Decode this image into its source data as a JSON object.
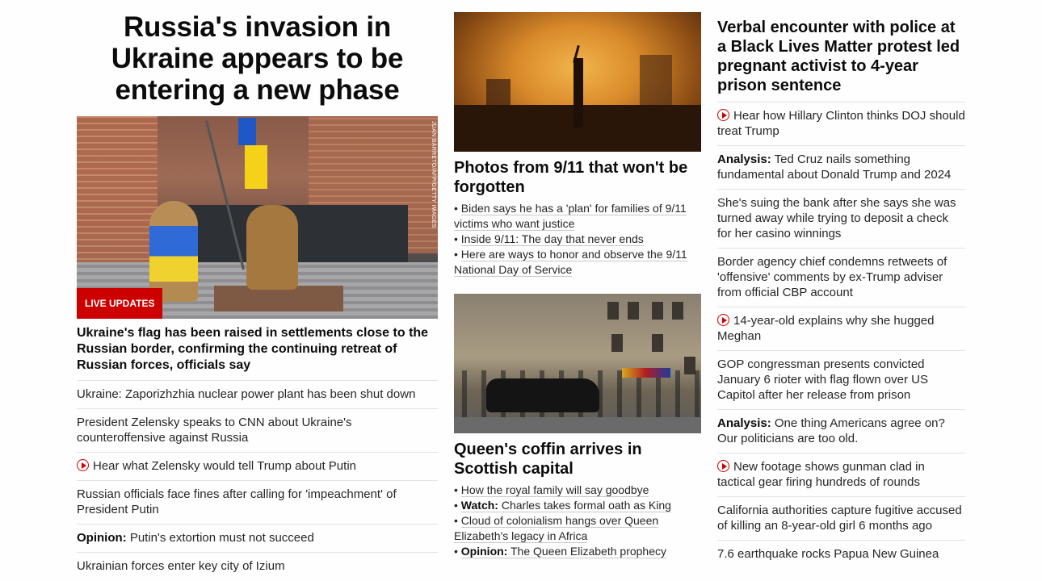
{
  "col1": {
    "hero_title": "Russia's invasion in Ukraine appears to be entering a new phase",
    "photo_credit": "JUAN BARRETO/AFP/GETTY IMAGES",
    "badge": "LIVE UPDATES",
    "lead_headline": "Ukraine's flag has been raised in settlements close to the Russian border, confirming the continuing retreat of Russian forces, officials say",
    "stories": [
      {
        "prefix": "",
        "text": "Ukraine: Zaporizhzhia nuclear power plant has been shut down",
        "video": false
      },
      {
        "prefix": "",
        "text": "President Zelensky speaks to CNN about Ukraine's counteroffensive against Russia",
        "video": false
      },
      {
        "prefix": "",
        "text": "Hear what Zelensky would tell Trump about Putin",
        "video": true
      },
      {
        "prefix": "",
        "text": "Russian officials face fines after calling for 'impeachment' of President Putin",
        "video": false
      },
      {
        "prefix": "Opinion:",
        "text": "Putin's extortion must not succeed",
        "video": false
      },
      {
        "prefix": "",
        "text": "Ukrainian forces enter key city of Izium",
        "video": false
      }
    ]
  },
  "col2": {
    "sec1": {
      "headline": "Photos from 9/11 that won't be forgotten",
      "bullets": [
        {
          "prefix": "",
          "text": "Biden says he has a 'plan' for families of 9/11 victims who want justice"
        },
        {
          "prefix": "",
          "text": "Inside 9/11: The day that never ends"
        },
        {
          "prefix": "",
          "text": "Here are ways to honor and observe the 9/11 National Day of Service"
        }
      ]
    },
    "sec2": {
      "headline": "Queen's coffin arrives in Scottish capital",
      "bullets": [
        {
          "prefix": "",
          "text": "How the royal family will say goodbye"
        },
        {
          "prefix": "Watch:",
          "text": "Charles takes formal oath as King"
        },
        {
          "prefix": "",
          "text": "Cloud of colonialism hangs over Queen Elizabeth's legacy in Africa"
        },
        {
          "prefix": "Opinion:",
          "text": "The Queen Elizabeth prophecy"
        }
      ]
    }
  },
  "col3": {
    "headline": "Verbal encounter with police at a Black Lives Matter protest led pregnant activist to 4-year prison sentence",
    "stories": [
      {
        "prefix": "",
        "text": "Hear how Hillary Clinton thinks DOJ should treat Trump",
        "video": true
      },
      {
        "prefix": "Analysis:",
        "text": "Ted Cruz nails something fundamental about Donald Trump and 2024",
        "video": false
      },
      {
        "prefix": "",
        "text": "She's suing the bank after she says she was turned away while trying to deposit a check for her casino winnings",
        "video": false
      },
      {
        "prefix": "",
        "text": "Border agency chief condemns retweets of 'offensive' comments by ex-Trump adviser from official CBP account",
        "video": false
      },
      {
        "prefix": "",
        "text": "14-year-old explains why she hugged Meghan",
        "video": true
      },
      {
        "prefix": "",
        "text": "GOP congressman presents convicted January 6 rioter with flag flown over US Capitol after her release from prison",
        "video": false
      },
      {
        "prefix": "Analysis:",
        "text": "One thing Americans agree on? Our politicians are too old.",
        "video": false
      },
      {
        "prefix": "",
        "text": "New footage shows gunman clad in tactical gear firing hundreds of rounds",
        "video": true
      },
      {
        "prefix": "",
        "text": "California authorities capture fugitive accused of killing an 8-year-old girl 6 months ago",
        "video": false
      },
      {
        "prefix": "",
        "text": "7.6 earthquake rocks Papua New Guinea",
        "video": false
      }
    ]
  },
  "colors": {
    "accent": "#cc0000",
    "text": "#0c0c0c",
    "divider": "#e3e3e3"
  }
}
